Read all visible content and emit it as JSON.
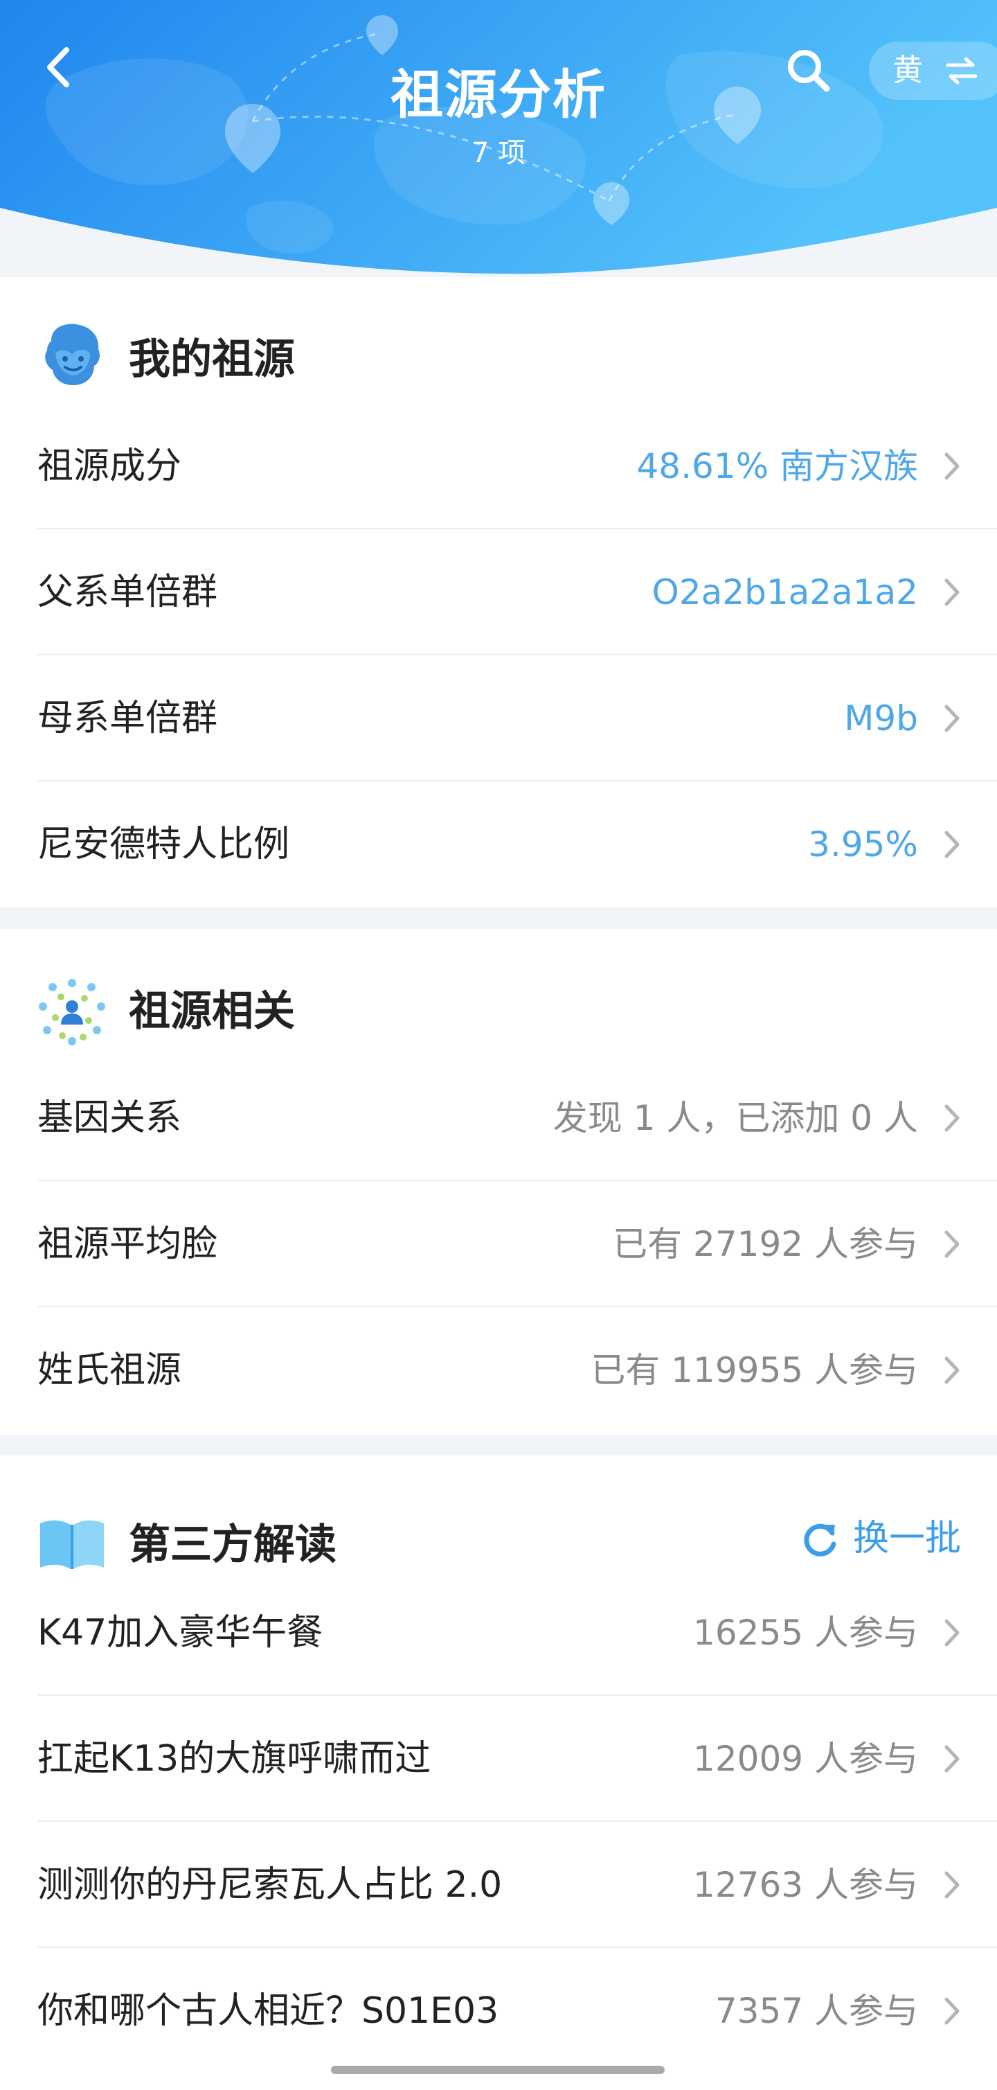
{
  "header": {
    "title": "祖源分析",
    "subtitle": "7 项",
    "lang_label": "黄",
    "back_icon": "back-arrow-icon",
    "search_icon": "search-icon",
    "swap_icon": "swap-icon",
    "bg_color_start": "#1f86ee",
    "bg_color_end": "#55c3fb"
  },
  "my_ancestry": {
    "title": "我的祖源",
    "icon": "ancestor-face-icon",
    "rows": [
      {
        "label": "祖源成分",
        "value": "48.61% 南方汉族"
      },
      {
        "label": "父系单倍群",
        "value": "O2a2b1a2a1a2"
      },
      {
        "label": "母系单倍群",
        "value": "M9b"
      },
      {
        "label": "尼安德特人比例",
        "value": "3.95%"
      }
    ]
  },
  "related": {
    "title": "祖源相关",
    "icon": "network-people-icon",
    "rows": [
      {
        "label": "基因关系",
        "value": "发现 1 人，已添加 0 人"
      },
      {
        "label": "祖源平均脸",
        "value": "已有 27192 人参与"
      },
      {
        "label": "姓氏祖源",
        "value": "已有 119955 人参与"
      }
    ]
  },
  "third_party": {
    "title": "第三方解读",
    "icon": "open-book-icon",
    "refresh_label": "换一批",
    "refresh_icon": "refresh-icon",
    "rows": [
      {
        "label": "K47加入豪华午餐",
        "value": "16255 人参与"
      },
      {
        "label": "扛起K13的大旗呼啸而过",
        "value": "12009 人参与"
      },
      {
        "label": "测测你的丹尼索瓦人占比 2.0",
        "value": "12763 人参与"
      },
      {
        "label": "你和哪个古人相近？S01E03",
        "value": "7357 人参与"
      }
    ]
  },
  "colors": {
    "accent_blue": "#4ea7e8",
    "muted_gray": "#8a8a8a"
  }
}
